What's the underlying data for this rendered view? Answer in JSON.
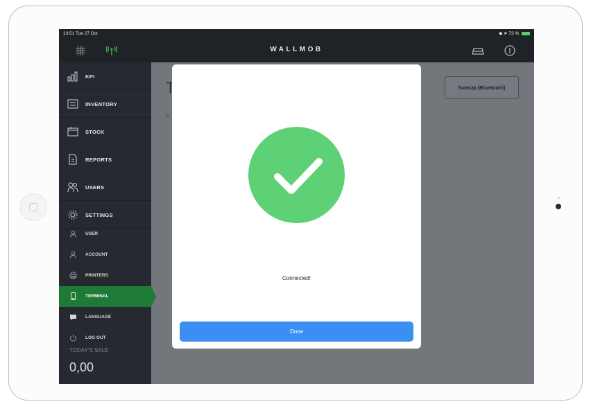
{
  "status_bar": {
    "time": "13:51  Tue 27 Oct",
    "battery": "73 %"
  },
  "header": {
    "brand": "WALLMOB"
  },
  "sidebar": {
    "items": [
      {
        "label": "KPI",
        "icon": "kpi-bars-icon"
      },
      {
        "label": "INVENTORY",
        "icon": "inventory-icon"
      },
      {
        "label": "STOCK",
        "icon": "stock-icon"
      },
      {
        "label": "REPORTS",
        "icon": "reports-icon"
      },
      {
        "label": "USERS",
        "icon": "users-icon"
      },
      {
        "label": "SETTINGS",
        "icon": "gear-icon"
      }
    ],
    "sub_items": [
      {
        "label": "USER",
        "icon": "user-icon"
      },
      {
        "label": "ACCOUNT",
        "icon": "account-icon"
      },
      {
        "label": "PRINTERS",
        "icon": "printer-icon"
      },
      {
        "label": "TERMINAL",
        "icon": "terminal-icon",
        "active": true
      },
      {
        "label": "LANGUAGE",
        "icon": "language-icon"
      },
      {
        "label": "LOG OUT",
        "icon": "power-icon"
      }
    ],
    "todays_sale_label": "TODAY'S SALE",
    "todays_sale_value": "0,00"
  },
  "main": {
    "title_glimpse": "T",
    "subtitle_glimpse": "S",
    "terminal_button": "SumUp (Bluetooth)"
  },
  "modal": {
    "message": "Connected!",
    "done_label": "Done"
  },
  "colors": {
    "accent_green": "#1e7a37",
    "success_green": "#5ed176",
    "primary_blue": "#3b8ff3"
  }
}
